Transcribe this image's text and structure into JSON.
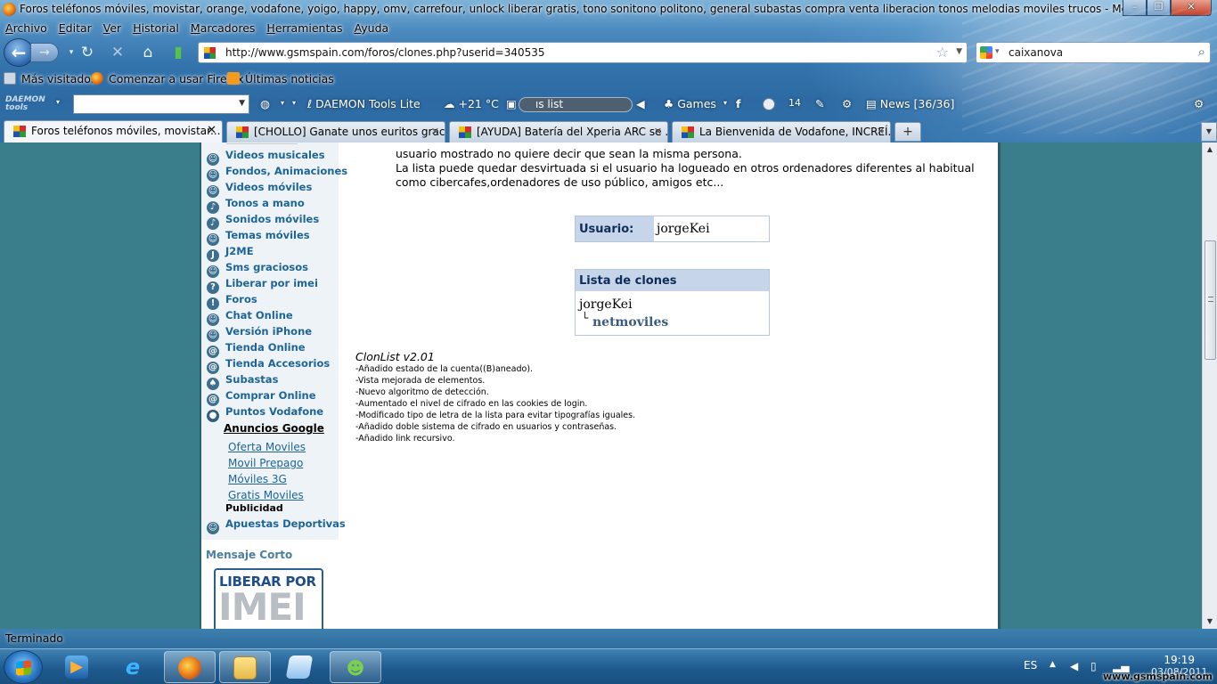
{
  "window": {
    "title": "Foros teléfonos móviles, movistar, orange, vodafone, yoigo, happy, omv, carrefour, unlock liberar gratis, tono sonitono politono, general subastas compra venta liberacion tonos melodias moviles trucos - Mozilla Firefox",
    "controls": [
      "–",
      "❐",
      "✕"
    ]
  },
  "menu": [
    "Archivo",
    "Editar",
    "Ver",
    "Historial",
    "Marcadores",
    "Herramientas",
    "Ayuda"
  ],
  "navigation": {
    "url": "http://www.gsmspain.com/foros/clones.php?userid=340535",
    "search_value": "caixanova"
  },
  "bookmarks": [
    "Más visitados",
    "Comenzar a usar Firefox",
    "Últimas noticias"
  ],
  "daemon_toolbar": {
    "logo": "DAEMON tools",
    "product": "DAEMON Tools Lite",
    "weather": "+21 °C",
    "playlist": "ıs list",
    "games": "Games",
    "news": "News [36/36]"
  },
  "tabs": [
    {
      "label": "Foros teléfonos móviles, movistar...",
      "active": true
    },
    {
      "label": "[CHOLLO] Ganate unos euritos grac...",
      "active": false
    },
    {
      "label": "[AYUDA] Batería del Xperia ARC se ...",
      "active": false
    },
    {
      "label": "La Bienvenida de Vodafone, INCREÍ...",
      "active": false
    }
  ],
  "sidebar": {
    "links": [
      {
        "label": "Videos musicales",
        "icon": "smiley-icon"
      },
      {
        "label": "Fondos, Animaciones",
        "icon": "smiley-icon"
      },
      {
        "label": "Videos móviles",
        "icon": "smiley-icon"
      },
      {
        "label": "Tonos a mano",
        "icon": "music-note-icon"
      },
      {
        "label": "Sonidos móviles",
        "icon": "music-note-icon"
      },
      {
        "label": "Temas móviles",
        "icon": "smiley-icon"
      },
      {
        "label": "J2ME",
        "icon": "java-icon"
      },
      {
        "label": "Sms graciosos",
        "icon": "smiley-icon"
      },
      {
        "label": "Liberar por imei",
        "icon": "unlock-icon"
      },
      {
        "label": "Foros",
        "icon": "forum-icon"
      },
      {
        "label": "Chat Online",
        "icon": "smiley-icon"
      },
      {
        "label": "Versión iPhone",
        "icon": "smiley-icon"
      },
      {
        "label": "Tienda Online",
        "icon": "at-icon"
      },
      {
        "label": "Tienda Accesorios",
        "icon": "at-icon"
      },
      {
        "label": "Subastas",
        "icon": "auction-icon"
      },
      {
        "label": "Comprar Online",
        "icon": "at-icon"
      },
      {
        "label": "Puntos Vodafone",
        "icon": "vodafone-icon"
      }
    ],
    "ads_title": "Anuncios Google",
    "ads": [
      "Oferta Moviles",
      "Movil Prepago",
      "Móviles 3G",
      "Gratis Moviles"
    ],
    "publicidad": "Publicidad",
    "extra_link": {
      "label": "Apuestas Deportivas",
      "icon": "smiley-icon"
    },
    "mensaje_corto": "Mensaje Corto",
    "banner_line1": "LIBERAR POR",
    "banner_line2": "IMEI"
  },
  "main": {
    "intro_line1": "usuario mostrado no quiere decir que sean la misma persona.",
    "intro_line2": "La lista puede quedar desvirtuada si el usuario ha logueado en otros ordenadores diferentes al habitual",
    "intro_line3": "como cibercafes,ordenadores de uso público, amigos etc...",
    "user_label": "Usuario:",
    "user_value": "jorgeKei",
    "clones_title": "Lista de clones",
    "clone_main": "jorgeKei",
    "clone_tree": "└",
    "clone_sub": "netmoviles",
    "version": "ClonList v2.01",
    "changelog": [
      "-Añadido estado de la cuenta((B)aneado).",
      "-Vista mejorada de elementos.",
      "-Nuevo algoritmo de detección.",
      "-Aumentado el nivel de cifrado en las cookies de login.",
      "-Modificado tipo de letra de la lista para evitar tipografías iguales.",
      "-Añadido doble sistema de cifrado en usuarios y contraseñas.",
      "-Añadido link recursivo."
    ]
  },
  "status": "Terminado",
  "taskbar": {
    "language": "ES",
    "time": "19:19",
    "date": "03/08/2011",
    "watermark": "www.gsmspain.com"
  }
}
